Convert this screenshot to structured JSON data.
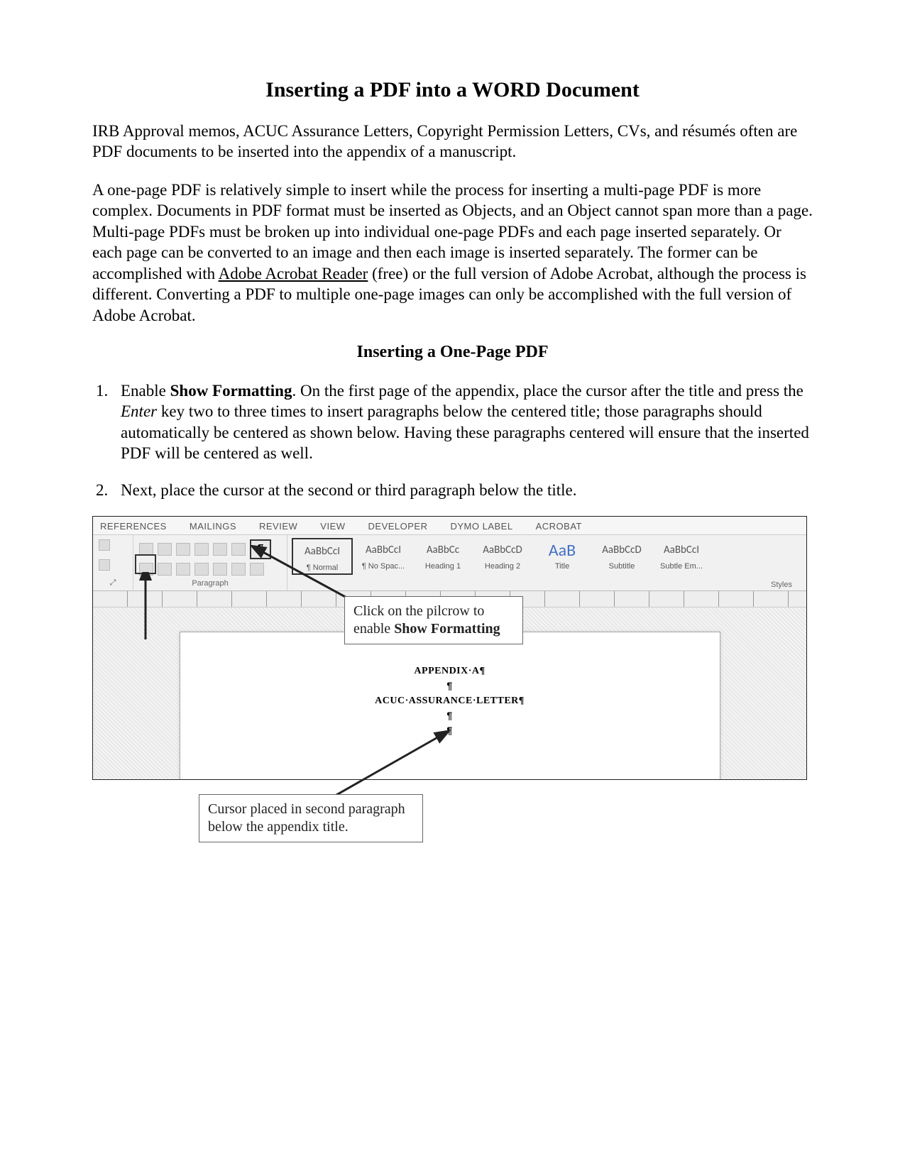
{
  "title": "Inserting a PDF into a WORD Document",
  "para1": "IRB Approval memos, ACUC Assurance Letters, Copyright Permission Letters, CVs, and résumés often are PDF documents to be inserted into the appendix of a manuscript.",
  "para2a": "A one-page PDF is relatively simple to insert while the process for inserting a multi-page PDF is more complex. Documents in PDF format must be inserted as Objects, and an Object cannot span more than a page. Multi-page PDFs must be broken up into individual one-page PDFs and each page inserted separately. Or each page can be converted to an image and then each image is inserted separately. The former can be accomplished with ",
  "para2_link": "Adobe Acrobat Reader",
  "para2b": " (free) or the full version of Adobe Acrobat, although the process is different. Converting a PDF to multiple one-page images can only be accomplished with the full version of Adobe Acrobat.",
  "subhead": "Inserting a One-Page PDF",
  "step1_a": "Enable ",
  "step1_bold": "Show Formatting",
  "step1_b": ". On the first page of the appendix, place the cursor after the title and press the ",
  "step1_ital": "Enter",
  "step1_c": " key two to three times to insert paragraphs below the centered title; those paragraphs should automatically be centered as shown below. Having these paragraphs centered will ensure that the inserted PDF will be centered as well.",
  "step2": "Next, place the cursor at the second or third paragraph below the title.",
  "ribbon": {
    "tabs": [
      "REFERENCES",
      "MAILINGS",
      "REVIEW",
      "VIEW",
      "DEVELOPER",
      "DYMO Label",
      "ACROBAT"
    ],
    "group_paragraph": "Paragraph",
    "group_styles": "Styles",
    "pilcrow": "¶",
    "styles": [
      {
        "preview": "AaBbCcI",
        "label": "¶ Normal",
        "sel": true
      },
      {
        "preview": "AaBbCcI",
        "label": "¶ No Spac..."
      },
      {
        "preview": "AaBbCc",
        "label": "Heading 1"
      },
      {
        "preview": "AaBbCcD",
        "label": "Heading 2"
      },
      {
        "preview": "AaB",
        "label": "Title",
        "big": true
      },
      {
        "preview": "AaBbCcD",
        "label": "Subtitle"
      },
      {
        "preview": "AaBbCcI",
        "label": "Subtle Em..."
      }
    ]
  },
  "doc": {
    "line1": "APPENDIX·A¶",
    "line2": "¶",
    "line3": "ACUC·ASSURANCE·LETTER¶",
    "line4": "¶",
    "cursor": "¶"
  },
  "callout1_a": "Click on the pilcrow to enable ",
  "callout1_b": "Show Formatting",
  "callout2": "Cursor placed in second paragraph below the appendix title."
}
